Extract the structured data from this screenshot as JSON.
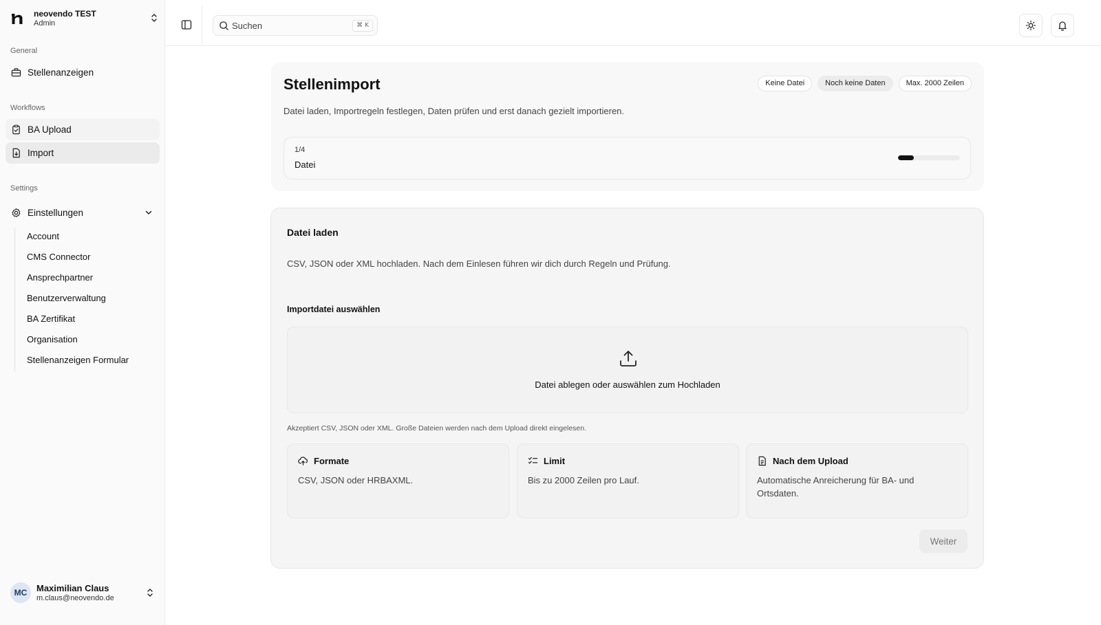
{
  "brand": {
    "name": "neovendo TEST",
    "role": "Admin"
  },
  "sidebar": {
    "general_label": "General",
    "stellenanzeigen": "Stellenanzeigen",
    "workflows_label": "Workflows",
    "ba_upload": "BA Upload",
    "import": "Import",
    "settings_label": "Settings",
    "einstellungen": "Einstellungen",
    "sub_items": [
      "Account",
      "CMS Connector",
      "Ansprechpartner",
      "Benutzerverwaltung",
      "BA Zertifikat",
      "Organisation",
      "Stellenanzeigen Formular"
    ]
  },
  "user": {
    "initials": "MC",
    "name": "Maximilian Claus",
    "email": "m.claus@neovendo.de"
  },
  "search": {
    "placeholder": "Suchen",
    "shortcut": "⌘ K"
  },
  "header": {
    "title": "Stellenimport",
    "subtitle": "Datei laden, Importregeln festlegen, Daten prüfen und erst danach gezielt importieren.",
    "badges": [
      "Keine Datei",
      "Noch keine Daten",
      "Max. 2000 Zeilen"
    ]
  },
  "stepper": {
    "count": "1/4",
    "label": "Datei",
    "progress": 0.25
  },
  "upload": {
    "title": "Datei laden",
    "description": "CSV, JSON oder XML hochladen. Nach dem Einlesen führen wir dich durch Regeln und Prüfung.",
    "field_label": "Importdatei auswählen",
    "dropzone_text": "Datei ablegen oder auswählen zum Hochladen",
    "hint": "Akzeptiert CSV, JSON oder XML. Große Dateien werden nach dem Upload direkt eingelesen.",
    "next_label": "Weiter"
  },
  "info_cards": [
    {
      "icon": "cloud-upload-icon",
      "title": "Formate",
      "body": "CSV, JSON oder HRBAXML."
    },
    {
      "icon": "list-checks-icon",
      "title": "Limit",
      "body": "Bis zu 2000 Zeilen pro Lauf."
    },
    {
      "icon": "file-text-icon",
      "title": "Nach dem Upload",
      "body": "Automatische Anreicherung für BA- und Ortsdaten."
    }
  ]
}
